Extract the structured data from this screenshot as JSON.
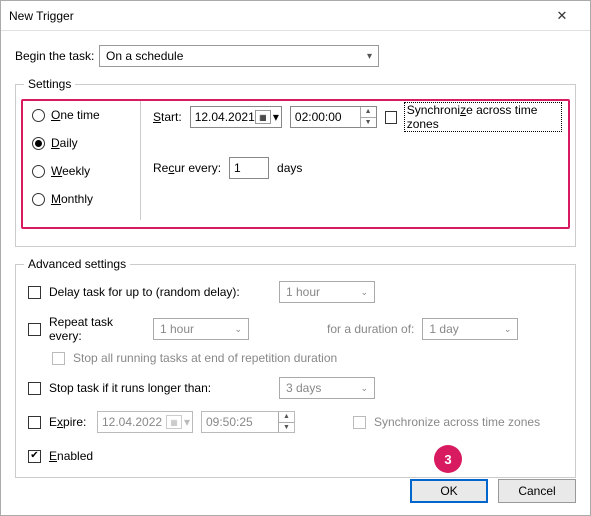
{
  "window": {
    "title": "New Trigger"
  },
  "begin": {
    "label": "Begin the task:",
    "value": "On a schedule"
  },
  "settings": {
    "legend": "Settings",
    "schedule_options": {
      "one_time": "One time",
      "daily": "Daily",
      "weekly": "Weekly",
      "monthly": "Monthly",
      "selected": "daily"
    },
    "start_label": "Start:",
    "start_date": "12.04.2021",
    "start_time": "02:00:00",
    "sync_tz_label": "Synchronize across time zones",
    "recur_label": "Recur every:",
    "recur_value": "1",
    "recur_unit": "days"
  },
  "advanced": {
    "legend": "Advanced settings",
    "delay_label": "Delay task for up to (random delay):",
    "delay_value": "1 hour",
    "repeat_label": "Repeat task every:",
    "repeat_value": "1 hour",
    "duration_label": "for a duration of:",
    "duration_value": "1 day",
    "stop_repetition_label": "Stop all running tasks at end of repetition duration",
    "stop_longer_label": "Stop task if it runs longer than:",
    "stop_longer_value": "3 days",
    "expire_label": "Expire:",
    "expire_date": "12.04.2022",
    "expire_time": "09:50:25",
    "expire_sync_label": "Synchronize across time zones",
    "enabled_label": "Enabled"
  },
  "footer": {
    "ok": "OK",
    "cancel": "Cancel"
  },
  "annotation": {
    "badge": "3"
  }
}
